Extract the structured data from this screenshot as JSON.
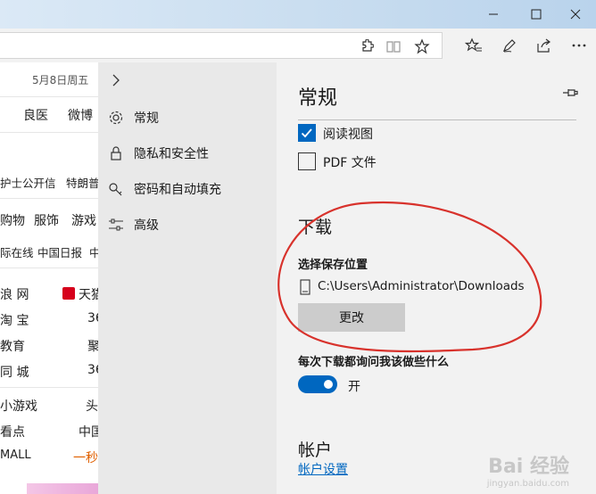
{
  "window": {
    "minimize": "—",
    "maximize": "☐",
    "close": "✕"
  },
  "toolbar": {
    "icons": [
      "extensions-icon",
      "reading-view-icon",
      "favorite-star-icon",
      "favorites-hub-icon",
      "pen-icon",
      "share-icon",
      "more-icon"
    ]
  },
  "webpage": {
    "date": "5月8日周五",
    "nav": [
      "良医",
      "微博"
    ],
    "row_news": [
      "护士公开信",
      "特朗普"
    ],
    "row_cats": [
      "购物",
      "服饰",
      "游戏"
    ],
    "row_sites": [
      "际在线",
      "中国日报",
      "中"
    ],
    "list": [
      {
        "left": "浪 网",
        "right": "天猫"
      },
      {
        "left": "淘 宝",
        "right": "36"
      },
      {
        "left": "教育",
        "right": "聚"
      },
      {
        "left": "同 城",
        "right": "36"
      },
      {
        "left": "小游戏",
        "right": "头"
      },
      {
        "left": "看点",
        "right": "中国"
      },
      {
        "left": "MALL",
        "right": "一秒"
      }
    ]
  },
  "nav": {
    "items": [
      {
        "label": "常规",
        "icon": "gear-icon"
      },
      {
        "label": "隐私和安全性",
        "icon": "lock-icon"
      },
      {
        "label": "密码和自动填充",
        "icon": "key-icon"
      },
      {
        "label": "高级",
        "icon": "sliders-icon"
      }
    ]
  },
  "settings": {
    "title": "常规",
    "reading_view": "阅读视图",
    "reading_view_checked": true,
    "pdf": "PDF 文件",
    "pdf_checked": false,
    "downloads_title": "下载",
    "save_location_label": "选择保存位置",
    "save_path": "C:\\Users\\Administrator\\Downloads",
    "change_button": "更改",
    "ask_label": "每次下载都询问我该做些什么",
    "ask_state": "开",
    "ask_on": true,
    "account_title": "帐户",
    "account_link": "帐户设置"
  },
  "watermark": {
    "brand": "Bai 经验",
    "url": "jingyan.baidu.com"
  },
  "colors": {
    "accent": "#0067c0",
    "annotation": "#d8322c"
  }
}
